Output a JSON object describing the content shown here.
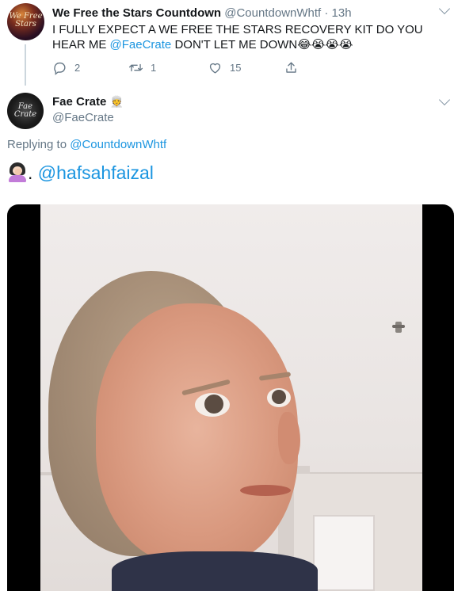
{
  "tweet1": {
    "author_name": "We Free the Stars Countdown",
    "handle": "@CountdownWhtf",
    "separator": "·",
    "time": "13h",
    "avatar_text": "We Free Stars",
    "text_before": "I FULLY EXPECT A WE FREE THE STARS RECOVERY KIT DO YOU HEAR ME ",
    "mention": "@FaeCrate",
    "text_after": " DON'T LET ME DOWN😂😭😭😭",
    "actions": {
      "reply_count": "2",
      "retweet_count": "1",
      "like_count": "15"
    }
  },
  "tweet2": {
    "author_name": "Fae Crate",
    "name_emoji": "👳",
    "handle": "@FaeCrate",
    "avatar_text": "Fae Crate",
    "replying_prefix": "Replying to ",
    "replying_to": "@CountdownWhtf",
    "text_prefix": ". ",
    "mention": "@hafsahfaizal",
    "media_icon": "woman-facepalming-emoji"
  },
  "colors": {
    "link": "#1b95e0",
    "muted": "#657786",
    "text": "#14171a",
    "thread_line": "#ccd6dd"
  },
  "icons": {
    "reply": "reply-icon",
    "retweet": "retweet-icon",
    "like": "heart-icon",
    "share": "share-icon",
    "more": "chevron-down-icon"
  }
}
